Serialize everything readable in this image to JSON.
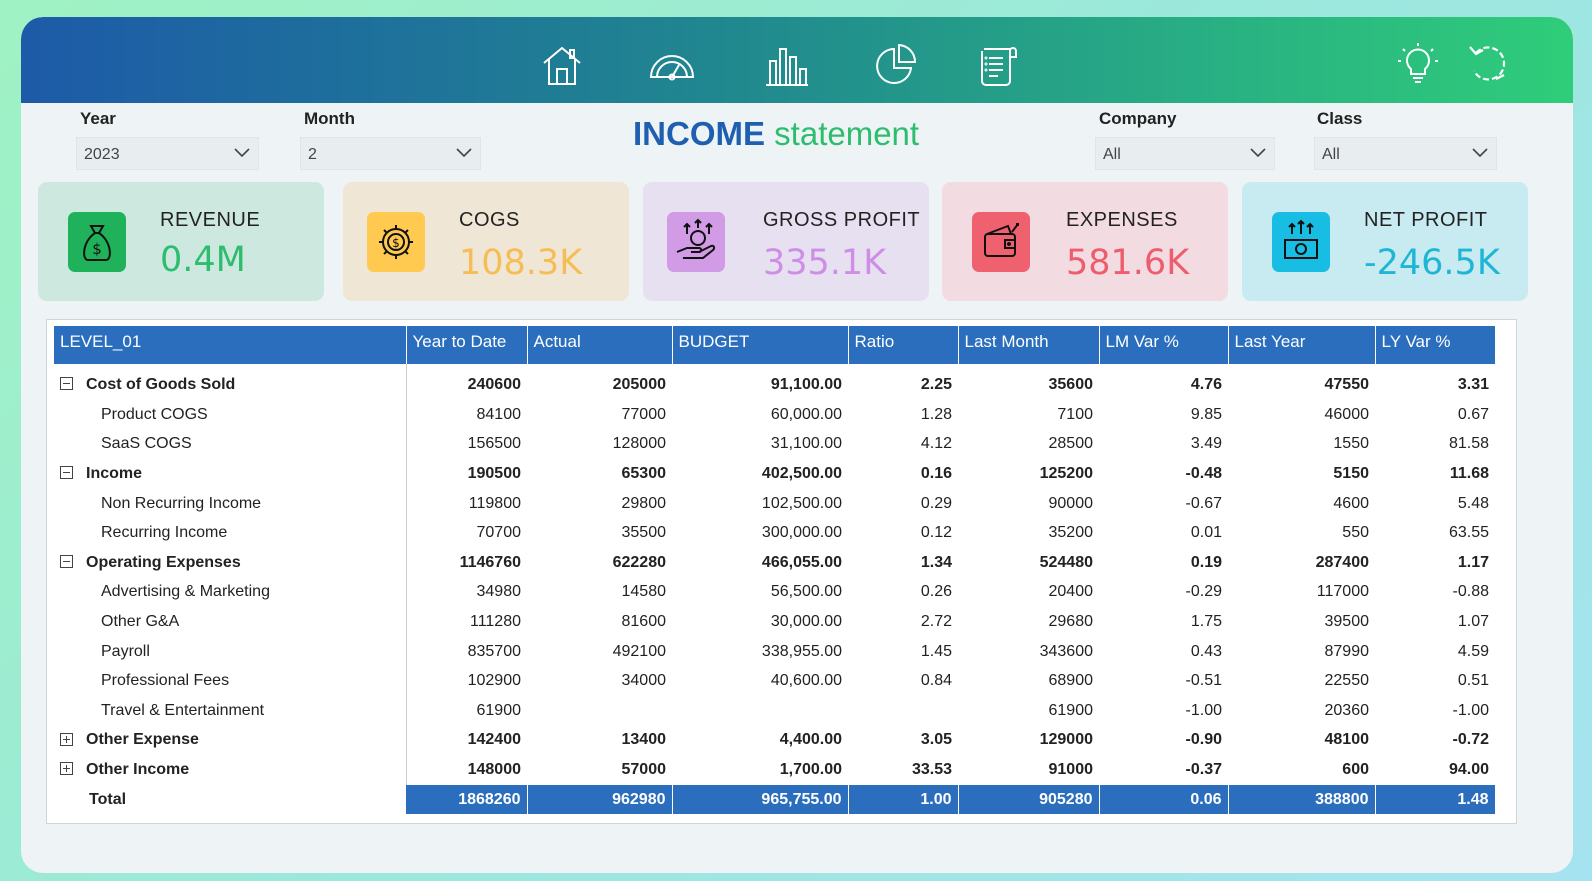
{
  "nav": {
    "icons": [
      "home-icon",
      "gauge-icon",
      "bar-chart-icon",
      "pie-chart-icon",
      "receipt-icon"
    ],
    "right_icons": [
      "lightbulb-icon",
      "reset-icon"
    ]
  },
  "filters": {
    "year_label": "Year",
    "year_value": "2023",
    "month_label": "Month",
    "month_value": "2",
    "company_label": "Company",
    "company_value": "All",
    "class_label": "Class",
    "class_value": "All"
  },
  "title": {
    "bold": "INCOME",
    "rest": "statement"
  },
  "kpis": [
    {
      "label": "REVENUE",
      "value": "0.4M",
      "color": "#2ebd6e",
      "bg": "#cde9df",
      "icon_bg": "#1fb25a",
      "icon": "money-bag-icon"
    },
    {
      "label": "COGS",
      "value": "108.3K",
      "color": "#f7bd55",
      "bg": "#efe6d5",
      "icon_bg": "#ffca4f",
      "icon": "gear-dollar-icon"
    },
    {
      "label": "GROSS PROFIT",
      "value": "335.1K",
      "color": "#cf8ee6",
      "bg": "#e7e0f1",
      "icon_bg": "#d19be6",
      "icon": "hand-coin-icon"
    },
    {
      "label": "EXPENSES",
      "value": "581.6K",
      "color": "#ef5c6d",
      "bg": "#f2dce2",
      "icon_bg": "#f0616f",
      "icon": "wallet-icon"
    },
    {
      "label": "NET PROFIT",
      "value": "-246.5K",
      "color": "#1fb6d6",
      "bg": "#c8ebf1",
      "icon_bg": "#18bde3",
      "icon": "cash-growth-icon"
    }
  ],
  "table": {
    "headers": [
      "LEVEL_01",
      "Year to Date",
      "Actual",
      "BUDGET",
      "Ratio",
      "Last Month",
      "LM Var %",
      "Last Year",
      "LY Var %"
    ],
    "rows": [
      {
        "type": "parent",
        "toggle": "minus",
        "cells": [
          "Cost of Goods Sold",
          "240600",
          "205000",
          "91,100.00",
          "2.25",
          "35600",
          "4.76",
          "47550",
          "3.31"
        ]
      },
      {
        "type": "child",
        "cells": [
          "Product COGS",
          "84100",
          "77000",
          "60,000.00",
          "1.28",
          "7100",
          "9.85",
          "46000",
          "0.67"
        ]
      },
      {
        "type": "child",
        "cells": [
          "SaaS COGS",
          "156500",
          "128000",
          "31,100.00",
          "4.12",
          "28500",
          "3.49",
          "1550",
          "81.58"
        ]
      },
      {
        "type": "parent",
        "toggle": "minus",
        "cells": [
          "Income",
          "190500",
          "65300",
          "402,500.00",
          "0.16",
          "125200",
          "-0.48",
          "5150",
          "11.68"
        ]
      },
      {
        "type": "child",
        "cells": [
          "Non Recurring Income",
          "119800",
          "29800",
          "102,500.00",
          "0.29",
          "90000",
          "-0.67",
          "4600",
          "5.48"
        ]
      },
      {
        "type": "child",
        "cells": [
          "Recurring Income",
          "70700",
          "35500",
          "300,000.00",
          "0.12",
          "35200",
          "0.01",
          "550",
          "63.55"
        ]
      },
      {
        "type": "parent",
        "toggle": "minus",
        "cells": [
          "Operating Expenses",
          "1146760",
          "622280",
          "466,055.00",
          "1.34",
          "524480",
          "0.19",
          "287400",
          "1.17"
        ]
      },
      {
        "type": "child",
        "cells": [
          "Advertising & Marketing",
          "34980",
          "14580",
          "56,500.00",
          "0.26",
          "20400",
          "-0.29",
          "117000",
          "-0.88"
        ]
      },
      {
        "type": "child",
        "cells": [
          "Other G&A",
          "111280",
          "81600",
          "30,000.00",
          "2.72",
          "29680",
          "1.75",
          "39500",
          "1.07"
        ]
      },
      {
        "type": "child",
        "cells": [
          "Payroll",
          "835700",
          "492100",
          "338,955.00",
          "1.45",
          "343600",
          "0.43",
          "87990",
          "4.59"
        ]
      },
      {
        "type": "child",
        "cells": [
          "Professional Fees",
          "102900",
          "34000",
          "40,600.00",
          "0.84",
          "68900",
          "-0.51",
          "22550",
          "0.51"
        ]
      },
      {
        "type": "child",
        "cells": [
          "Travel & Entertainment",
          "61900",
          "",
          "",
          "",
          "61900",
          "-1.00",
          "20360",
          "-1.00"
        ]
      },
      {
        "type": "parent",
        "toggle": "plus",
        "cells": [
          "Other Expense",
          "142400",
          "13400",
          "4,400.00",
          "3.05",
          "129000",
          "-0.90",
          "48100",
          "-0.72"
        ]
      },
      {
        "type": "parent",
        "toggle": "plus",
        "cells": [
          "Other Income",
          "148000",
          "57000",
          "1,700.00",
          "33.53",
          "91000",
          "-0.37",
          "600",
          "94.00"
        ]
      }
    ],
    "total": [
      "Total",
      "1868260",
      "962980",
      "965,755.00",
      "1.00",
      "905280",
      "0.06",
      "388800",
      "1.48"
    ]
  }
}
